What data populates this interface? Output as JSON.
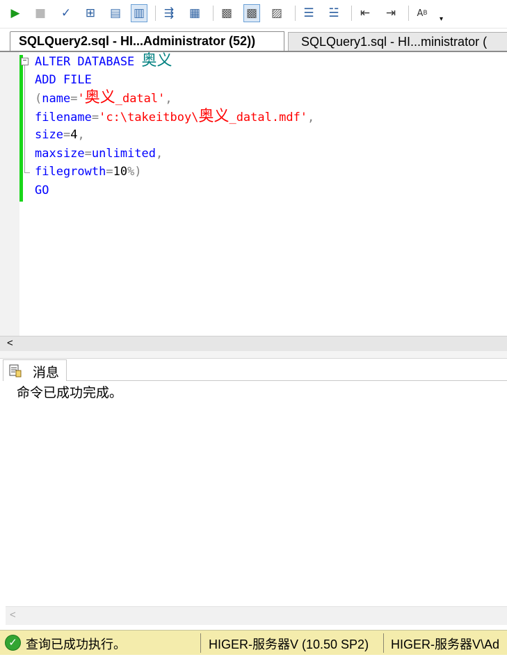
{
  "toolbar": {
    "icons": [
      "execute-icon",
      "stop-icon",
      "parse-icon",
      "estimated-plan-icon",
      "query-options-icon",
      "intellisense-icon",
      "results-to-text-icon",
      "results-to-grid-icon",
      "results-to-file-icon",
      "include-plan-icon",
      "client-stats-icon",
      "live-stats-icon",
      "comment-icon",
      "uncomment-icon",
      "decrease-indent-icon",
      "increase-indent-icon",
      "specify-values-icon"
    ]
  },
  "tabs": [
    {
      "label": "SQLQuery2.sql - HI...Administrator (52))",
      "active": true
    },
    {
      "label": "SQLQuery1.sql - HI...ministrator (",
      "active": false
    }
  ],
  "editor": {
    "lines": [
      {
        "parts": [
          [
            "kw",
            "ALTER DATABASE "
          ],
          [
            "grn",
            "奥义"
          ]
        ]
      },
      {
        "parts": [
          [
            "kw",
            "ADD FILE"
          ]
        ]
      },
      {
        "parts": [
          [
            "gray",
            "("
          ],
          [
            "kw",
            "name"
          ],
          [
            "gray",
            "="
          ],
          [
            "str",
            "'"
          ],
          [
            "str",
            "奥义"
          ],
          [
            "str",
            "_datal'"
          ],
          [
            "gray",
            ","
          ]
        ]
      },
      {
        "parts": [
          [
            "kw",
            "filename"
          ],
          [
            "gray",
            "="
          ],
          [
            "str",
            "'c:\\takeitboy\\"
          ],
          [
            "str",
            "奥义"
          ],
          [
            "str",
            "_datal.mdf'"
          ],
          [
            "gray",
            ","
          ]
        ]
      },
      {
        "parts": [
          [
            "kw",
            "size"
          ],
          [
            "gray",
            "="
          ],
          [
            "num",
            "4"
          ],
          [
            "gray",
            ","
          ]
        ]
      },
      {
        "parts": [
          [
            "kw",
            "maxsize"
          ],
          [
            "gray",
            "="
          ],
          [
            "kw",
            "unlimited"
          ],
          [
            "gray",
            ","
          ]
        ]
      },
      {
        "parts": [
          [
            "kw",
            "filegrowth"
          ],
          [
            "gray",
            "="
          ],
          [
            "num",
            "10"
          ],
          [
            "gray",
            "%)"
          ]
        ]
      },
      {
        "parts": [
          [
            "kw",
            "GO"
          ]
        ]
      }
    ]
  },
  "results": {
    "tab_label": "消息",
    "message": "命令已成功完成。"
  },
  "status": {
    "text": "查询已成功执行。",
    "server": "HIGER-服务器V (10.50 SP2)",
    "login": "HIGER-服务器V\\Ad"
  }
}
